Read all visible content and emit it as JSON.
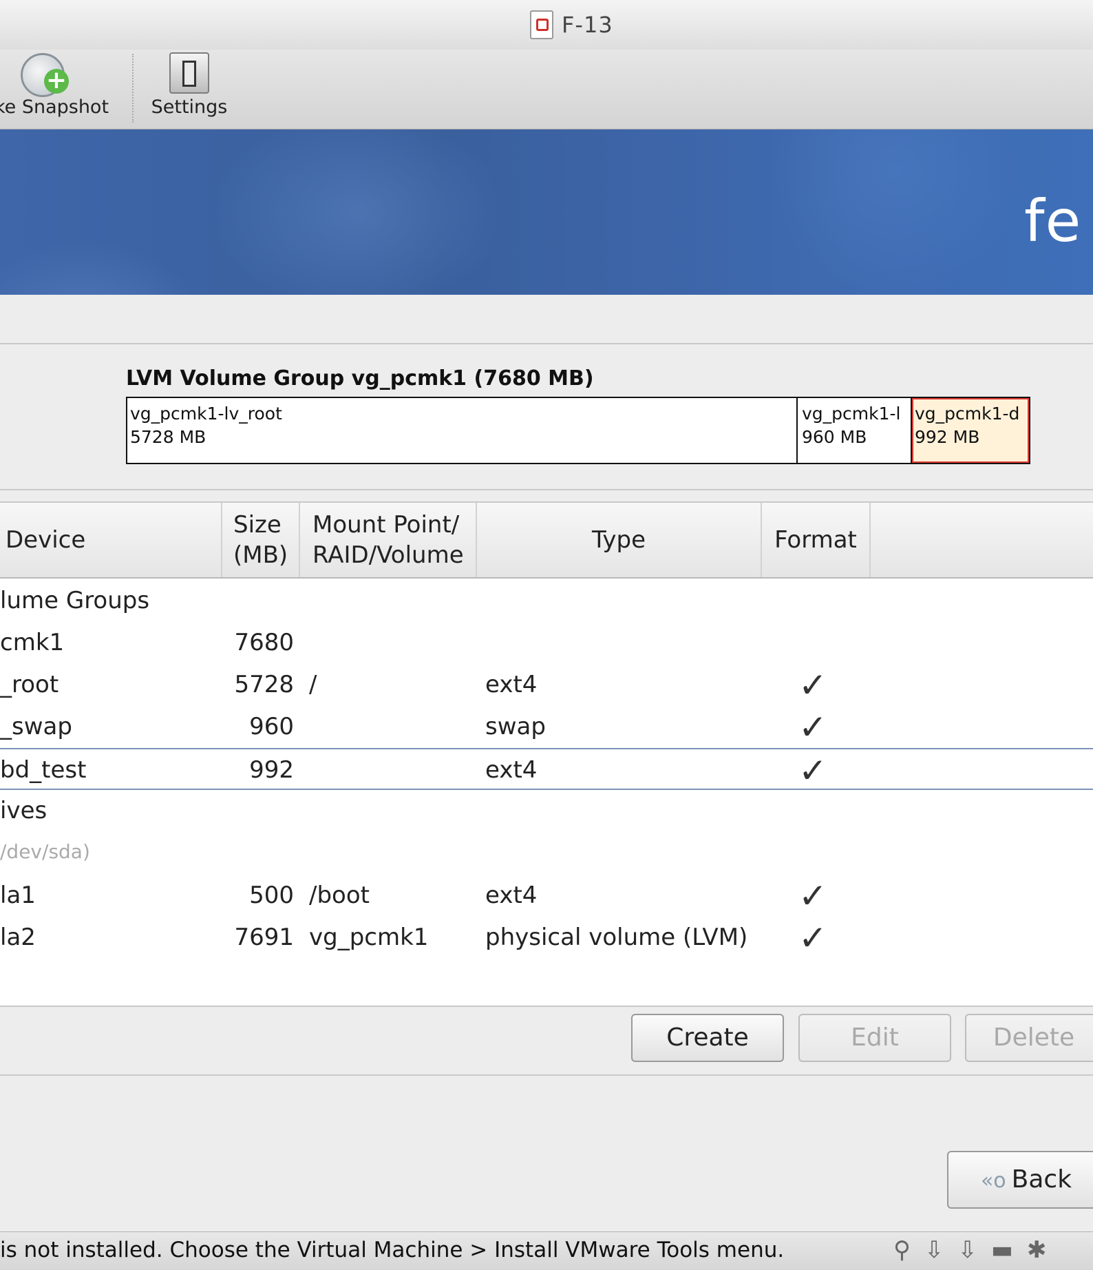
{
  "window": {
    "title": "F-13"
  },
  "toolbar": {
    "snapshot_label": "ke Snapshot",
    "settings_label": "Settings"
  },
  "banner": {
    "brand_text": "fe"
  },
  "lvm": {
    "title": "LVM Volume Group vg_pcmk1 (7680 MB)",
    "segments": [
      {
        "name": "vg_pcmk1-lv_root",
        "size": "5728 MB"
      },
      {
        "name": "vg_pcmk1-l",
        "size": "960 MB"
      },
      {
        "name": "vg_pcmk1-d",
        "size": "992 MB"
      }
    ]
  },
  "table": {
    "headers": {
      "device": "Device",
      "size_line1": "Size",
      "size_line2": "(MB)",
      "mount_line1": "Mount Point/",
      "mount_line2": "RAID/Volume",
      "type": "Type",
      "format": "Format"
    },
    "rows": [
      {
        "device": "lume Groups",
        "size": "",
        "mount": "",
        "type": "",
        "format": ""
      },
      {
        "device": "cmk1",
        "size": "7680",
        "mount": "",
        "type": "",
        "format": ""
      },
      {
        "device": "_root",
        "size": "5728",
        "mount": "/",
        "type": "ext4",
        "format": "✓"
      },
      {
        "device": "_swap",
        "size": "960",
        "mount": "",
        "type": "swap",
        "format": "✓"
      },
      {
        "device": "bd_test",
        "size": "992",
        "mount": "",
        "type": "ext4",
        "format": "✓"
      },
      {
        "device": "ives",
        "size": "",
        "mount": "",
        "type": "",
        "format": ""
      },
      {
        "device": "/dev/sda)",
        "size": "",
        "mount": "",
        "type": "",
        "format": ""
      },
      {
        "device": "la1",
        "size": "500",
        "mount": "/boot",
        "type": "ext4",
        "format": "✓"
      },
      {
        "device": "la2",
        "size": "7691",
        "mount": "vg_pcmk1",
        "type": "physical volume (LVM)",
        "format": "✓"
      }
    ]
  },
  "buttons": {
    "create": "Create",
    "edit": "Edit",
    "delete": "Delete",
    "back": "Back"
  },
  "status": {
    "text": "is not installed. Choose the Virtual Machine > Install VMware Tools menu."
  },
  "colors": {
    "banner": "#3e66a8",
    "selection_outline": "#7c93b8",
    "free_segment_border": "#e03a32"
  }
}
